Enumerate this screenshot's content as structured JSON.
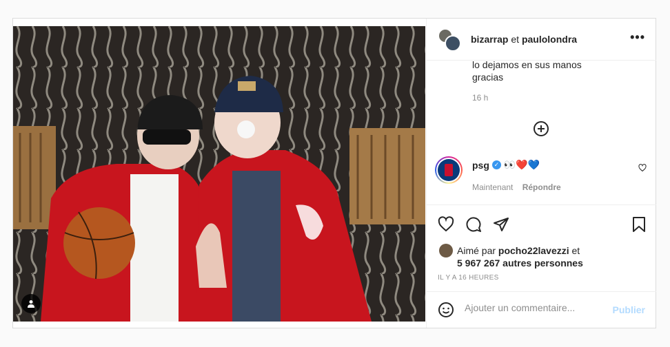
{
  "post": {
    "author_primary": "bizarrap",
    "author_joiner": "et",
    "author_secondary": "paulolondra",
    "more_label": "•••"
  },
  "caption": {
    "lines": [
      "lo dejamos en sus manos",
      "gracias"
    ],
    "time": "16 h"
  },
  "comment": {
    "user": "psg",
    "verified": true,
    "text": "👀❤️💙",
    "time": "Maintenant",
    "reply_label": "Répondre"
  },
  "likes": {
    "prefix": "Aimé par",
    "user": "pocho22lavezzi",
    "joiner": "et",
    "count": "5 967 267 autres personnes"
  },
  "posted_ago": "IL Y A 16 HEURES",
  "comment_box": {
    "placeholder": "Ajouter un commentaire...",
    "publish_label": "Publier"
  },
  "colors": {
    "link_disabled": "#b3dbff",
    "verified": "#3897f0",
    "secondary_text": "#8e8e8e"
  }
}
